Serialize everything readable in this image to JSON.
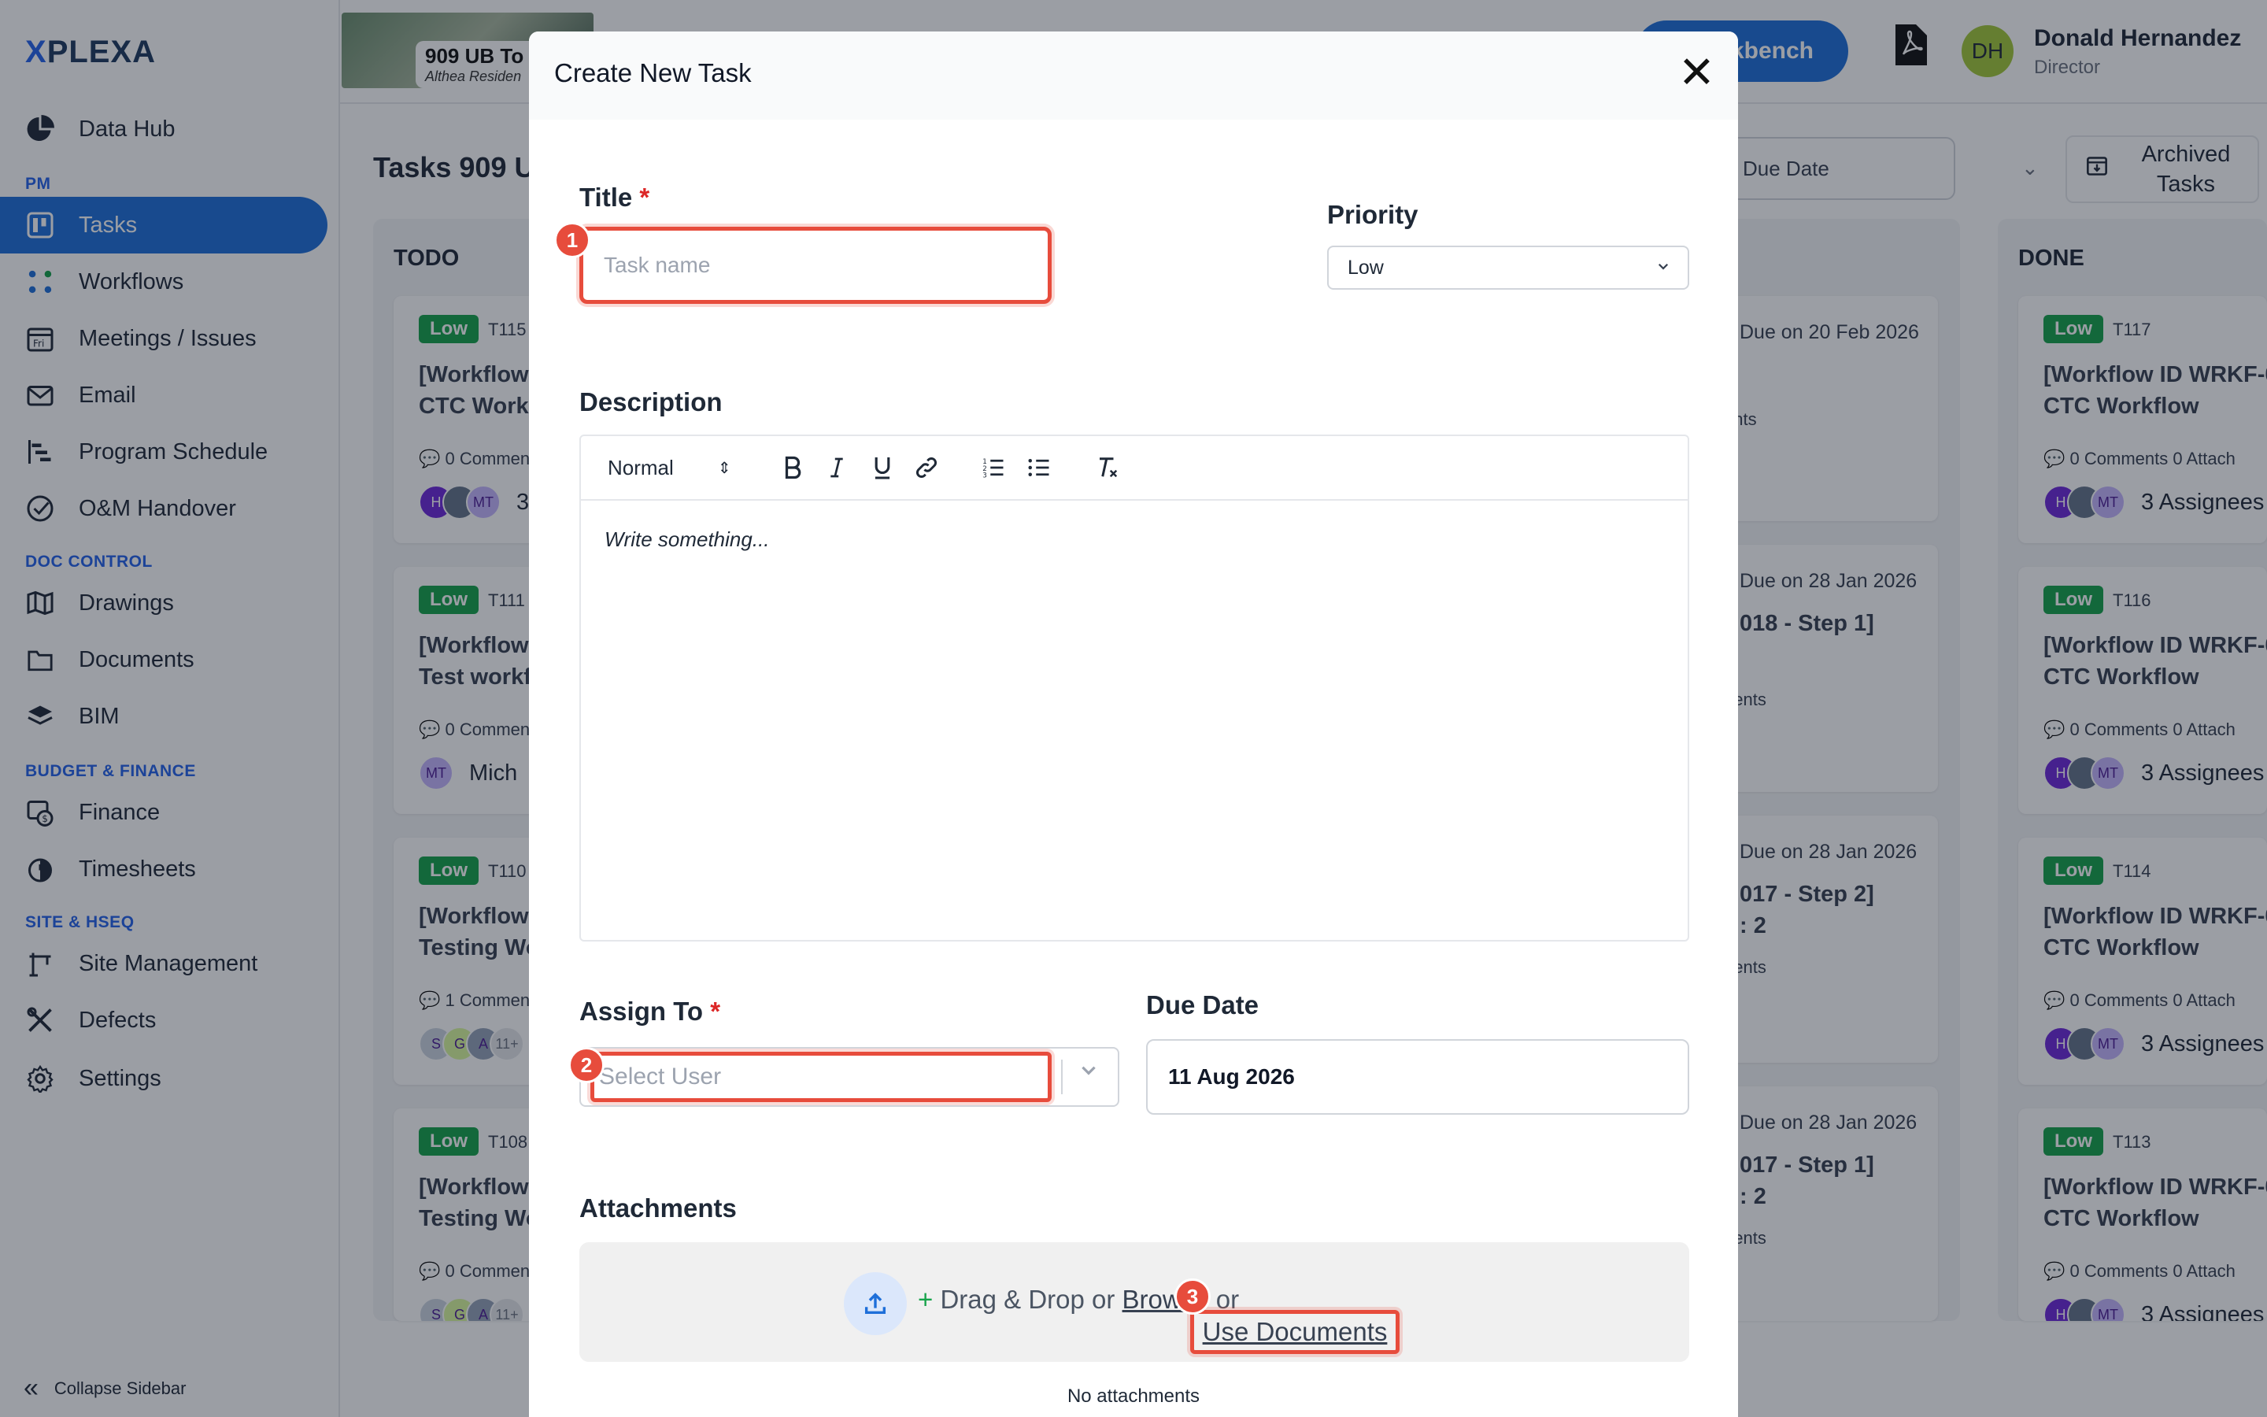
{
  "app": {
    "logo_prefix": "X",
    "logo_text": "PLEXA"
  },
  "sidebar": {
    "data_hub": "Data Hub",
    "sec_pm": "PM",
    "tasks": "Tasks",
    "workflows": "Workflows",
    "meetings": "Meetings / Issues",
    "email": "Email",
    "program_schedule": "Program Schedule",
    "om_handover": "O&M Handover",
    "sec_doc": "DOC CONTROL",
    "drawings": "Drawings",
    "documents": "Documents",
    "bim": "BIM",
    "sec_budget": "BUDGET & FINANCE",
    "finance": "Finance",
    "timesheets": "Timesheets",
    "sec_site": "SITE & HSEQ",
    "site_management": "Site Management",
    "defects": "Defects",
    "settings": "Settings",
    "collapse": "Collapse Sidebar"
  },
  "topbar": {
    "project_name": "909 UB To",
    "project_sub": "Althea Residen",
    "workbench": "rkbench",
    "user_initials": "DH",
    "user_name": "Donald Hernandez",
    "user_role": "Director"
  },
  "board": {
    "title": "Tasks 909 U",
    "sort_label": "Due Date",
    "archived": "Archived Tasks",
    "todo_title": "TODO",
    "done_title": "DONE",
    "todo_cards": [
      {
        "badge": "Low",
        "id": "T115",
        "line1": "[Workflow",
        "line2": "CTC Workf",
        "meta": "0 Commen",
        "avatars": [
          "H",
          "",
          "MT"
        ],
        "label": "3"
      },
      {
        "badge": "Low",
        "id": "T111",
        "line1": "[Workflow",
        "line2": "Test workf",
        "meta": "0 Commen",
        "avatars": [
          "MT"
        ],
        "label": "Mich"
      },
      {
        "badge": "Low",
        "id": "T110",
        "line1": "[Workflow",
        "line2": "Testing Wo",
        "meta": "1 Commen",
        "avatars": [
          "S",
          "G",
          "A",
          "11+"
        ],
        "label": ""
      },
      {
        "badge": "Low",
        "id": "T108",
        "line1": "[Workflow",
        "line2": "Testing Wo",
        "meta": "0 Commen",
        "avatars": [
          "S",
          "G",
          "A",
          "11+"
        ],
        "label": ""
      }
    ],
    "mid_cards": [
      {
        "due": "Due on 20 Feb 2026",
        "line1": "",
        "line2": "",
        "meta": "ents"
      },
      {
        "due": "Due on 28 Jan 2026",
        "line1": "018 - Step 1]",
        "line2": "",
        "meta": "nents"
      },
      {
        "due": "Due on 28 Jan 2026",
        "line1": "017 - Step 2]",
        "line2": ": 2",
        "meta": "nents"
      },
      {
        "due": "Due on 28 Jan 2026",
        "line1": "017 - Step 1]",
        "line2": ": 2",
        "meta": "nents"
      }
    ],
    "done_cards": [
      {
        "badge": "Low",
        "id": "T117",
        "line1": "[Workflow ID WRKF-0",
        "line2": "CTC Workflow",
        "meta": "0 Comments   0 Attach",
        "avatars": [
          "H",
          "",
          "MT"
        ],
        "label": "3 Assignees"
      },
      {
        "badge": "Low",
        "id": "T116",
        "line1": "[Workflow ID WRKF-0",
        "line2": "CTC Workflow",
        "meta": "0 Comments   0 Attach",
        "avatars": [
          "H",
          "",
          "MT"
        ],
        "label": "3 Assignees"
      },
      {
        "badge": "Low",
        "id": "T114",
        "line1": "[Workflow ID WRKF-0",
        "line2": "CTC Workflow",
        "meta": "0 Comments   0 Attach",
        "avatars": [
          "H",
          "",
          "MT"
        ],
        "label": "3 Assignees"
      },
      {
        "badge": "Low",
        "id": "T113",
        "line1": "[Workflow ID WRKF-0",
        "line2": "CTC Workflow",
        "meta": "0 Comments   0 Attach",
        "avatars": [
          "H",
          "",
          "MT"
        ],
        "label": "3 Assignees"
      }
    ]
  },
  "modal": {
    "title": "Create New Task",
    "close_glyph": "✕",
    "title_label": "Title",
    "required_mark": "*",
    "title_placeholder": "Task name",
    "priority_label": "Priority",
    "priority_value": "Low",
    "description_label": "Description",
    "editor_format": "Normal",
    "editor_placeholder": "Write something...",
    "assign_label": "Assign To",
    "assign_placeholder": "Select User",
    "due_label": "Due Date",
    "due_value": "11 Aug 2026",
    "attachments_label": "Attachments",
    "dz_plus": "+",
    "dz_drag": "Drag & Drop or",
    "dz_browse": "Browse",
    "dz_or": "or",
    "dz_use_docs": "Use Documents",
    "no_attachments": "No attachments"
  },
  "markers": [
    "1",
    "2",
    "3"
  ],
  "colors": {
    "accent": "#1e6fd9",
    "highlight": "#e74c3c",
    "badge_low": "#16a34a"
  }
}
